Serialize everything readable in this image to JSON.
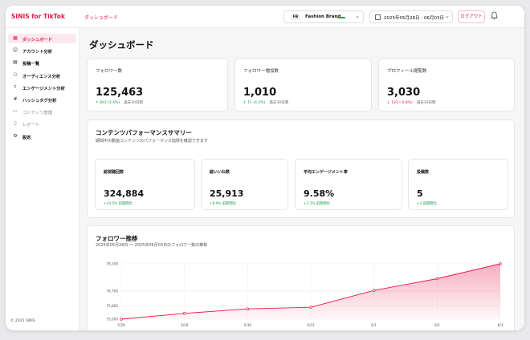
{
  "header": {
    "brand": "SINIS for TikTok",
    "page": "ダッシュボード",
    "account": {
      "badge": "FB",
      "name": "Fashion Brand",
      "indicator_color": "#1aa34a"
    },
    "date_range": "2025年05月28日 - 06月03日",
    "logout_label": "ログアウト"
  },
  "sidebar": {
    "items": [
      {
        "icon": "grid-icon",
        "glyph": "▦",
        "label": "ダッシュボード",
        "active": true
      },
      {
        "icon": "user-icon",
        "glyph": "☺",
        "label": "アカウント分析"
      },
      {
        "icon": "video-icon",
        "glyph": "▤",
        "label": "投稿一覧"
      },
      {
        "icon": "audience-icon",
        "glyph": "⚇",
        "label": "オーディエンス分析"
      },
      {
        "icon": "share-icon",
        "glyph": "⇪",
        "label": "エンゲージメント分析"
      },
      {
        "icon": "hashtag-icon",
        "glyph": "#",
        "label": "ハッシュタグ分析"
      },
      {
        "icon": "content-icon",
        "glyph": "▭",
        "label": "コンテンツ管理",
        "dim": true
      },
      {
        "icon": "report-icon",
        "glyph": "▯",
        "label": "レポート",
        "dim": true
      },
      {
        "icon": "gear-icon",
        "glyph": "⚙",
        "label": "設定"
      }
    ],
    "footer": "© 2025 SINIS"
  },
  "main": {
    "title": "ダッシュボード",
    "stats": [
      {
        "label": "フォロワー数",
        "value": "125,463",
        "change": "↑ 843 (2.4%)",
        "direction": "up",
        "note": "過去30日間"
      },
      {
        "label": "フォロワー増加数",
        "value": "1,010",
        "change": "↑ 11 (4.2%)",
        "direction": "up",
        "note": "過去30日間"
      },
      {
        "label": "プロフィール閲覧数",
        "value": "3,030",
        "change": "↓ 123 (-0.8%)",
        "direction": "down",
        "note": "過去30日間"
      }
    ],
    "performance": {
      "title": "コンテンツパフォーマンスサマリー",
      "subtitle": "期間中の動画コンテンツのパフォーマンス指標を確認できます",
      "metrics": [
        {
          "label": "総視聴回数",
          "value": "324,884",
          "change": "+14.5% 前期間比"
        },
        {
          "label": "総いいね数",
          "value": "25,913",
          "change": "+8.9% 前期間比"
        },
        {
          "label": "平均エンゲージメント率",
          "value": "9.58%",
          "change": "+2.1% 前期間比"
        },
        {
          "label": "投稿数",
          "value": "5",
          "change": "+3 前期間比"
        }
      ]
    },
    "follower_chart": {
      "title": "フォロワー推移",
      "subtitle": "2025年05月28日 〜 2025年06月03日のフォロワー数の推移"
    }
  },
  "chart_data": {
    "type": "area",
    "title": "フォロワー推移",
    "x": [
      "5/28",
      "5/29",
      "5/30",
      "5/31",
      "6/1",
      "6/2",
      "6/3"
    ],
    "y_ticks": [
      "75,000",
      "75,800",
      "76,700",
      "78,349"
    ],
    "ylim": [
      75000,
      78349
    ],
    "series": [
      {
        "values": [
          75000,
          75350,
          75620,
          75720,
          76740,
          77450,
          78349
        ]
      }
    ],
    "line_color": "#e8194a",
    "grid": true
  }
}
